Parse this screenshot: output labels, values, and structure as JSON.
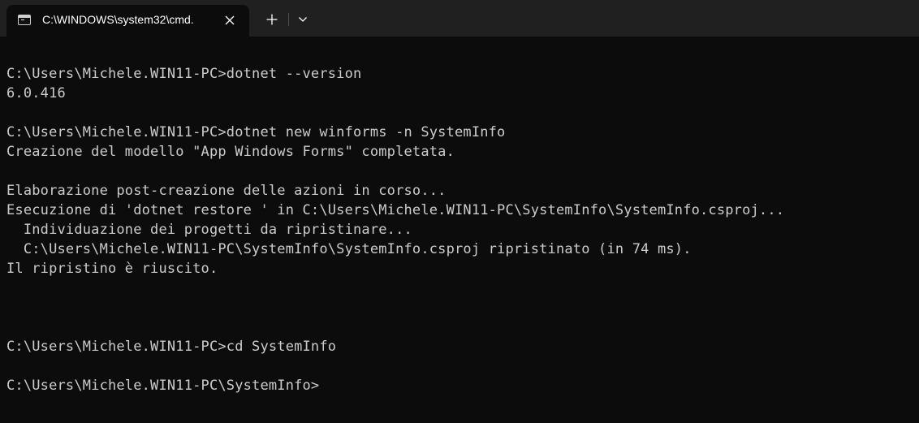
{
  "window": {
    "tab_title": "C:\\WINDOWS\\system32\\cmd.",
    "tab_icon": "cmd-icon",
    "close_icon": "close-icon",
    "new_tab_icon": "plus-icon",
    "dropdown_icon": "chevron-down-icon"
  },
  "colors": {
    "titlebar": "#202020",
    "terminal_bg": "#0c0c0c",
    "terminal_fg": "#cccccc"
  },
  "terminal": {
    "lines": [
      "C:\\Users\\Michele.WIN11-PC>dotnet --version",
      "6.0.416",
      "",
      "C:\\Users\\Michele.WIN11-PC>dotnet new winforms -n SystemInfo",
      "Creazione del modello \"App Windows Forms\" completata.",
      "",
      "Elaborazione post-creazione delle azioni in corso...",
      "Esecuzione di 'dotnet restore ' in C:\\Users\\Michele.WIN11-PC\\SystemInfo\\SystemInfo.csproj...",
      "  Individuazione dei progetti da ripristinare...",
      "  C:\\Users\\Michele.WIN11-PC\\SystemInfo\\SystemInfo.csproj ripristinato (in 74 ms).",
      "Il ripristino è riuscito.",
      "",
      "",
      "",
      "C:\\Users\\Michele.WIN11-PC>cd SystemInfo",
      "",
      "C:\\Users\\Michele.WIN11-PC\\SystemInfo>"
    ]
  }
}
